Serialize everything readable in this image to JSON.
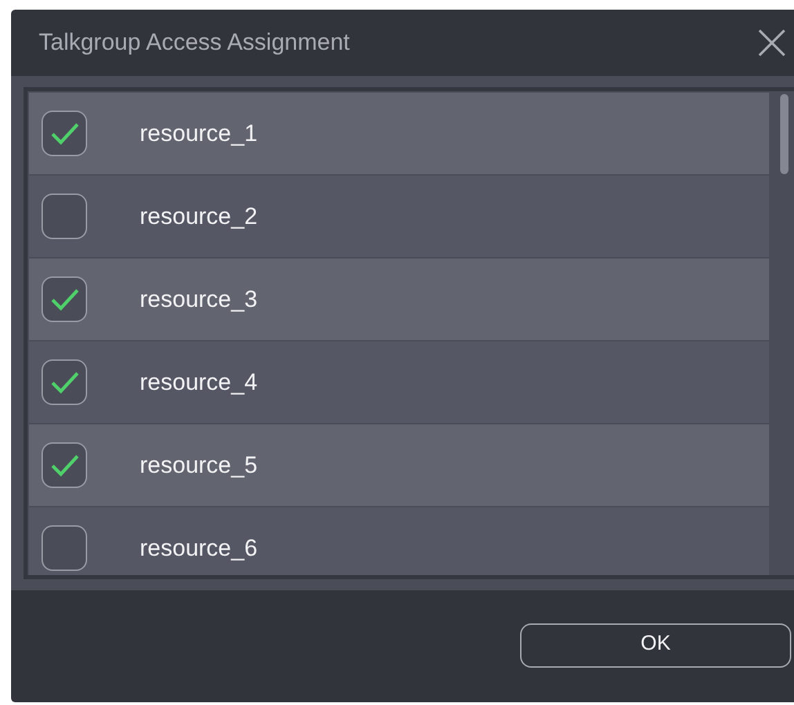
{
  "window": {
    "title": "Talkgroup Access Assignment"
  },
  "items": [
    {
      "label": "resource_1",
      "checked": true
    },
    {
      "label": "resource_2",
      "checked": false
    },
    {
      "label": "resource_3",
      "checked": true
    },
    {
      "label": "resource_4",
      "checked": true
    },
    {
      "label": "resource_5",
      "checked": true
    },
    {
      "label": "resource_6",
      "checked": false
    }
  ],
  "buttons": [
    "OK"
  ]
}
